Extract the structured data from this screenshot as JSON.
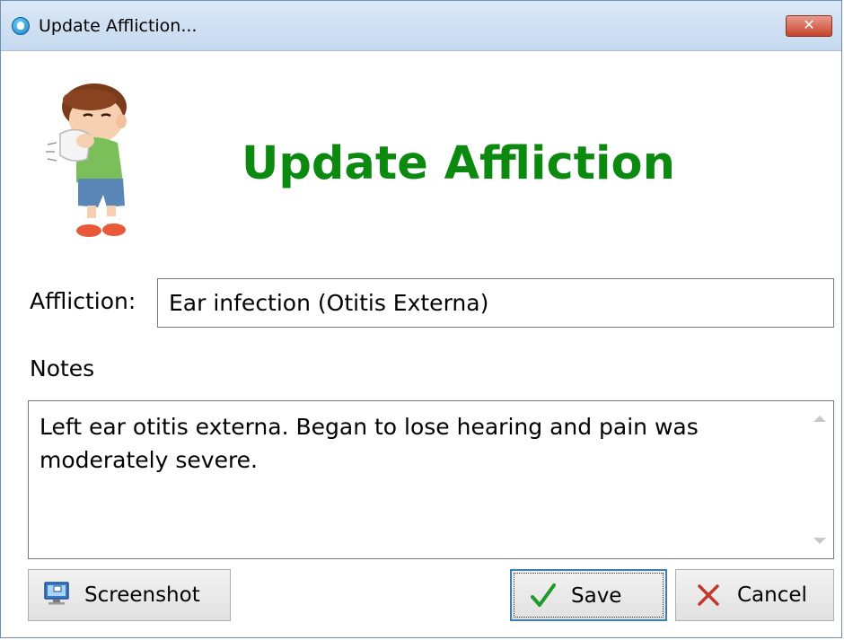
{
  "window": {
    "title": "Update Affliction...",
    "close_label": "✕"
  },
  "header": {
    "heading": "Update Affliction"
  },
  "form": {
    "affliction_label": "Affliction:",
    "affliction_value": "Ear infection (Otitis Externa)",
    "notes_label": "Notes",
    "notes_value": "Left ear otitis externa. Began to lose hearing and pain was moderately severe."
  },
  "buttons": {
    "screenshot_label": "Screenshot",
    "save_label": "Save",
    "cancel_label": "Cancel"
  },
  "colors": {
    "heading": "#0c8a10",
    "titlebar": "#dbe8f6",
    "close": "#c7442d",
    "focus_border": "#3c7fb1"
  },
  "icons": {
    "app": "app-icon",
    "illustration": "sneezing-child-illustration",
    "screenshot": "monitor-icon",
    "save": "checkmark-icon",
    "cancel": "x-icon"
  }
}
